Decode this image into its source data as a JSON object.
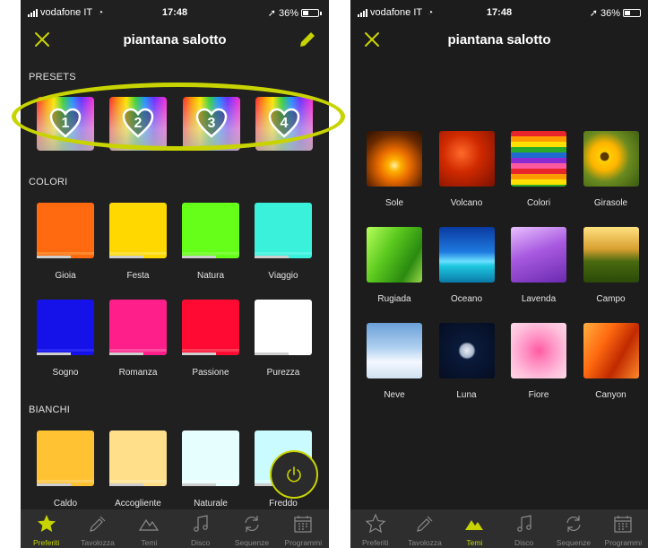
{
  "left": {
    "status": {
      "carrier": "vodafone IT",
      "time": "17:48",
      "battery": "36%"
    },
    "title": "piantana salotto",
    "presets_label": "PRESETS",
    "presets": [
      "1",
      "2",
      "3",
      "4"
    ],
    "colori_label": "COLORI",
    "colori": [
      {
        "label": "Gioia",
        "color": "#ff6a10",
        "stripe": "#ff8a2e"
      },
      {
        "label": "Festa",
        "color": "#ffd800",
        "stripe": "#ffe23a"
      },
      {
        "label": "Natura",
        "color": "#66ff1a",
        "stripe": "#7dff3a"
      },
      {
        "label": "Viaggio",
        "color": "#3af2dc",
        "stripe": "#58f5e4"
      },
      {
        "label": "Sogno",
        "color": "#1412e8",
        "stripe": "#2a28f0"
      },
      {
        "label": "Romanza",
        "color": "#ff1f8a",
        "stripe": "#ff4ea0"
      },
      {
        "label": "Passione",
        "color": "#ff0a32",
        "stripe": "#ff3a55"
      },
      {
        "label": "Purezza",
        "color": "#ffffff",
        "stripe": "#ffffff"
      }
    ],
    "bianchi_label": "BIANCHI",
    "bianchi": [
      {
        "label": "Caldo",
        "color": "#ffc233",
        "stripe": "#ffd060"
      },
      {
        "label": "Accogliente",
        "color": "#ffdf8a",
        "stripe": "#ffe7a4"
      },
      {
        "label": "Naturale",
        "color": "#e6fffe",
        "stripe": "#f0ffff"
      },
      {
        "label": "Freddo",
        "color": "#c9fbff",
        "stripe": "#dcfdff"
      }
    ],
    "tabs": [
      {
        "label": "Preferiti",
        "icon": "star-icon",
        "active": true
      },
      {
        "label": "Tavolozza",
        "icon": "eyedropper-icon",
        "active": false
      },
      {
        "label": "Temi",
        "icon": "mountains-icon",
        "active": false
      },
      {
        "label": "Disco",
        "icon": "music-note-icon",
        "active": false
      },
      {
        "label": "Sequenze",
        "icon": "cycle-arrows-icon",
        "active": false
      },
      {
        "label": "Programmi",
        "icon": "calendar-icon",
        "active": false
      }
    ],
    "accent": "#c8d400"
  },
  "right": {
    "status": {
      "carrier": "vodafone IT",
      "time": "17:48",
      "battery": "36%"
    },
    "title": "piantana salotto",
    "themes": [
      {
        "label": "Sole",
        "bg": "radial-gradient(circle at 50% 62%, #fff3a0 0%, #ffb000 14%, #e86a00 36%, #6b2a00 70%, #2a1200 100%)"
      },
      {
        "label": "Volcano",
        "bg": "radial-gradient(circle at 40% 40%, #ff6a2a 0%, #d02a00 40%, #7a1000 100%)"
      },
      {
        "label": "Colori",
        "bg": "repeating-linear-gradient(180deg, #e8252a 0 6px, #ff9a00 6px 12px, #ffe000 12px 18px, #2aa82a 18px 24px, #1e6ad0 24px 30px, #8a2ad0 30px 36px, #ff5aa0 36px 42px)"
      },
      {
        "label": "Girasole",
        "bg": "radial-gradient(circle at 38% 46%, #5a3a00 0%, #5a3a00 9%, #ffd000 10%, #ffb400 30%, #6a8a20 55%, #3a5a10 100%)"
      },
      {
        "label": "Rugiada",
        "bg": "linear-gradient(120deg, #b6ff5a 0%, #5ac81e 40%, #2a8a10 75%, #9ad84a 100%)"
      },
      {
        "label": "Oceano",
        "bg": "linear-gradient(180deg, #0a3aa0 0%, #1e7ae0 45%, #6ae0ff 62%, #1ec8e0 70%, #0a7aa8 100%)"
      },
      {
        "label": "Lavenda",
        "bg": "linear-gradient(160deg, #e8c0ff 0%, #a85ae0 45%, #6a2ab0 100%)"
      },
      {
        "label": "Campo",
        "bg": "linear-gradient(180deg, #ffe080 0%, #d8a030 40%, #4a6a10 62%, #2a4a08 100%)"
      },
      {
        "label": "Neve",
        "bg": "linear-gradient(180deg, #6aa0d8 0%, #b0d0f0 45%, #f4f8ff 70%, #d0e0f0 100%)"
      },
      {
        "label": "Luna",
        "bg": "radial-gradient(circle at 50% 50%, #e8eef8 0%, #a8b4c8 17%, #0a1a3a 22%, #050d22 100%)"
      },
      {
        "label": "Fiore",
        "bg": "radial-gradient(circle at 50% 50%, #ff5aa0 0%, #ff8ac0 30%, #ffc0dc 70%, #ffd8e8 100%)"
      },
      {
        "label": "Canyon",
        "bg": "linear-gradient(120deg, #ffb040 0%, #ff6a10 35%, #c02a00 65%, #ff8a2a 100%)"
      }
    ],
    "tabs": [
      {
        "label": "Preferiti",
        "icon": "star-outline-icon",
        "active": false
      },
      {
        "label": "Tavolozza",
        "icon": "eyedropper-icon",
        "active": false
      },
      {
        "label": "Temi",
        "icon": "mountains-icon",
        "active": true
      },
      {
        "label": "Disco",
        "icon": "music-note-icon",
        "active": false
      },
      {
        "label": "Sequenze",
        "icon": "cycle-arrows-icon",
        "active": false
      },
      {
        "label": "Programmi",
        "icon": "calendar-icon",
        "active": false
      }
    ]
  }
}
